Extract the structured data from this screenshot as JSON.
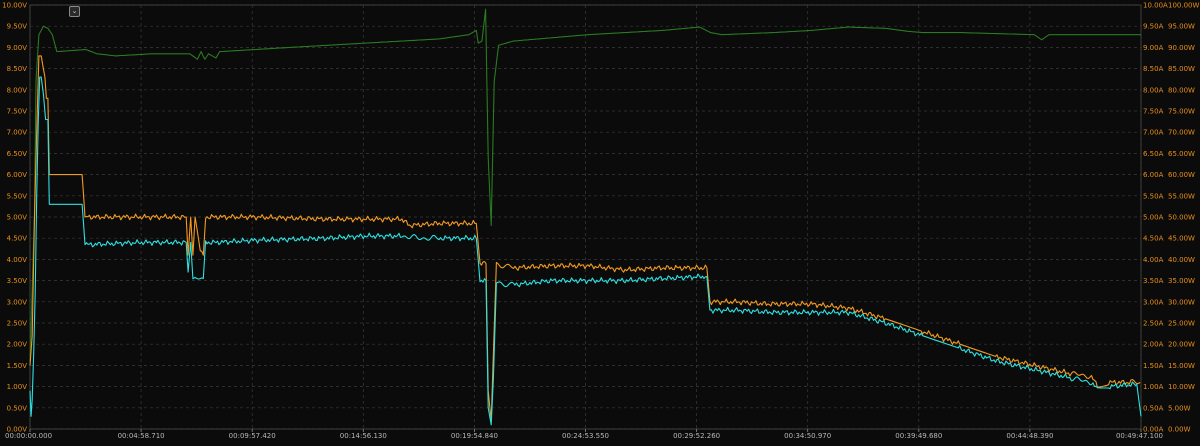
{
  "chart_data": {
    "type": "line",
    "title": "",
    "collapse_icon": "chevron-down-icon",
    "grid": true,
    "background": "#0b0b0b",
    "x_ticks": [
      "00:00:00.000",
      "00:04:58.710",
      "00:09:57.420",
      "00:14:56.130",
      "00:19:54.840",
      "00:24:53.550",
      "00:29:52.260",
      "00:34:50.970",
      "00:39:49.680",
      "00:44:48.390",
      "00:49:47.100"
    ],
    "x_range_seconds": [
      0,
      2987.1
    ],
    "axes": {
      "voltage": {
        "side": "left",
        "color": "#e8901c",
        "ylim": [
          0,
          10
        ],
        "ticks": [
          "0.00V",
          "0.50V",
          "1.00V",
          "1.50V",
          "2.00V",
          "2.50V",
          "3.00V",
          "3.50V",
          "4.00V",
          "4.50V",
          "5.00V",
          "5.50V",
          "6.00V",
          "6.50V",
          "7.00V",
          "7.50V",
          "8.00V",
          "8.50V",
          "9.00V",
          "9.50V",
          "10.00V"
        ]
      },
      "current": {
        "side": "right-inner",
        "color": "#e8901c",
        "ylim": [
          0,
          10
        ],
        "ticks": [
          "0.00A",
          "0.50A",
          "1.00A",
          "1.50A",
          "2.00A",
          "2.50A",
          "3.00A",
          "3.50A",
          "4.00A",
          "4.50A",
          "5.00A",
          "5.50A",
          "6.00A",
          "6.50A",
          "7.00A",
          "7.50A",
          "8.00A",
          "8.50A",
          "9.00A",
          "9.50A",
          "10.00A"
        ]
      },
      "power": {
        "side": "right-outer",
        "color": "#e8901c",
        "ylim": [
          0,
          100
        ],
        "ticks": [
          "0.00W",
          "5.00W",
          "10.00W",
          "15.00W",
          "20.00W",
          "25.00W",
          "30.00W",
          "35.00W",
          "40.00W",
          "45.00W",
          "50.00W",
          "55.00W",
          "60.00W",
          "65.00W",
          "70.00W",
          "75.00W",
          "80.00W",
          "85.00W",
          "90.00W",
          "95.00W",
          "100.00W"
        ]
      }
    },
    "series": [
      {
        "color": "#2a7a22",
        "axis": "voltage",
        "points": [
          [
            0,
            1.6
          ],
          [
            12,
            5.1
          ],
          [
            16,
            8.2
          ],
          [
            24,
            9.3
          ],
          [
            36,
            9.5
          ],
          [
            48,
            9.45
          ],
          [
            60,
            9.3
          ],
          [
            72,
            8.9
          ],
          [
            150,
            8.95
          ],
          [
            180,
            8.85
          ],
          [
            230,
            8.8
          ],
          [
            330,
            8.85
          ],
          [
            430,
            8.85
          ],
          [
            450,
            8.72
          ],
          [
            460,
            8.9
          ],
          [
            470,
            8.72
          ],
          [
            480,
            8.85
          ],
          [
            500,
            8.75
          ],
          [
            510,
            8.9
          ],
          [
            700,
            9.0
          ],
          [
            900,
            9.1
          ],
          [
            1100,
            9.2
          ],
          [
            1180,
            9.3
          ],
          [
            1200,
            9.4
          ],
          [
            1205,
            9.1
          ],
          [
            1215,
            9.15
          ],
          [
            1225,
            9.9
          ],
          [
            1232,
            6.4
          ],
          [
            1240,
            4.8
          ],
          [
            1248,
            8.2
          ],
          [
            1260,
            9.05
          ],
          [
            1300,
            9.15
          ],
          [
            1500,
            9.3
          ],
          [
            1700,
            9.4
          ],
          [
            1800,
            9.48
          ],
          [
            1830,
            9.35
          ],
          [
            1860,
            9.3
          ],
          [
            2000,
            9.35
          ],
          [
            2100,
            9.4
          ],
          [
            2200,
            9.48
          ],
          [
            2300,
            9.45
          ],
          [
            2360,
            9.38
          ],
          [
            2400,
            9.35
          ],
          [
            2500,
            9.35
          ],
          [
            2700,
            9.3
          ],
          [
            2720,
            9.18
          ],
          [
            2740,
            9.3
          ],
          [
            2987,
            9.3
          ]
        ]
      },
      {
        "color": "#f29a22",
        "axis": "voltage",
        "points": [
          [
            0,
            1.5
          ],
          [
            6,
            2.2
          ],
          [
            12,
            5.0
          ],
          [
            18,
            7.0
          ],
          [
            24,
            8.8
          ],
          [
            30,
            8.8
          ],
          [
            40,
            8.3
          ],
          [
            44,
            7.8
          ],
          [
            48,
            7.8
          ],
          [
            52,
            6.0
          ],
          [
            60,
            6.0
          ],
          [
            140,
            6.0
          ],
          [
            148,
            5.0
          ],
          [
            160,
            5.0
          ],
          [
            300,
            5.0
          ],
          [
            420,
            5.0
          ],
          [
            425,
            4.1
          ],
          [
            432,
            5.0
          ],
          [
            438,
            4.1
          ],
          [
            444,
            5.0
          ],
          [
            458,
            4.2
          ],
          [
            466,
            4.1
          ],
          [
            472,
            5.0
          ],
          [
            600,
            5.0
          ],
          [
            800,
            4.95
          ],
          [
            1000,
            4.95
          ],
          [
            1020,
            4.8
          ],
          [
            1100,
            4.85
          ],
          [
            1200,
            4.85
          ],
          [
            1210,
            3.9
          ],
          [
            1226,
            3.9
          ],
          [
            1232,
            0.9
          ],
          [
            1240,
            0.2
          ],
          [
            1246,
            1.8
          ],
          [
            1254,
            3.9
          ],
          [
            1300,
            3.8
          ],
          [
            1400,
            3.85
          ],
          [
            1500,
            3.85
          ],
          [
            1600,
            3.75
          ],
          [
            1700,
            3.8
          ],
          [
            1820,
            3.8
          ],
          [
            1828,
            3.0
          ],
          [
            1900,
            3.0
          ],
          [
            1980,
            2.95
          ],
          [
            2100,
            2.95
          ],
          [
            2200,
            2.85
          ],
          [
            2300,
            2.6
          ],
          [
            2400,
            2.3
          ],
          [
            2500,
            2.0
          ],
          [
            2600,
            1.7
          ],
          [
            2700,
            1.5
          ],
          [
            2800,
            1.3
          ],
          [
            2850,
            1.25
          ],
          [
            2870,
            1.05
          ],
          [
            2900,
            1.1
          ],
          [
            2960,
            1.1
          ],
          [
            2985,
            1.1
          ]
        ]
      },
      {
        "color": "#2ee0e0",
        "axis": "voltage",
        "points": [
          [
            0,
            0.9
          ],
          [
            3,
            0.3
          ],
          [
            6,
            0.7
          ],
          [
            10,
            1.8
          ],
          [
            14,
            3.2
          ],
          [
            18,
            5.5
          ],
          [
            22,
            7.2
          ],
          [
            26,
            8.3
          ],
          [
            30,
            8.3
          ],
          [
            36,
            7.9
          ],
          [
            42,
            7.3
          ],
          [
            48,
            7.3
          ],
          [
            52,
            5.3
          ],
          [
            60,
            5.3
          ],
          [
            140,
            5.3
          ],
          [
            148,
            4.35
          ],
          [
            160,
            4.35
          ],
          [
            300,
            4.4
          ],
          [
            420,
            4.4
          ],
          [
            425,
            3.7
          ],
          [
            432,
            4.4
          ],
          [
            438,
            3.55
          ],
          [
            444,
            3.55
          ],
          [
            466,
            3.55
          ],
          [
            472,
            4.4
          ],
          [
            500,
            4.4
          ],
          [
            600,
            4.45
          ],
          [
            800,
            4.5
          ],
          [
            900,
            4.55
          ],
          [
            1000,
            4.55
          ],
          [
            1050,
            4.5
          ],
          [
            1100,
            4.5
          ],
          [
            1200,
            4.5
          ],
          [
            1210,
            3.5
          ],
          [
            1226,
            3.5
          ],
          [
            1232,
            0.5
          ],
          [
            1240,
            0.1
          ],
          [
            1246,
            1.2
          ],
          [
            1254,
            3.45
          ],
          [
            1300,
            3.4
          ],
          [
            1400,
            3.5
          ],
          [
            1500,
            3.5
          ],
          [
            1600,
            3.5
          ],
          [
            1700,
            3.55
          ],
          [
            1820,
            3.6
          ],
          [
            1828,
            2.8
          ],
          [
            1900,
            2.8
          ],
          [
            2000,
            2.75
          ],
          [
            2100,
            2.75
          ],
          [
            2200,
            2.75
          ],
          [
            2300,
            2.5
          ],
          [
            2400,
            2.2
          ],
          [
            2500,
            1.9
          ],
          [
            2600,
            1.6
          ],
          [
            2700,
            1.4
          ],
          [
            2800,
            1.2
          ],
          [
            2850,
            1.1
          ],
          [
            2870,
            0.95
          ],
          [
            2900,
            1.0
          ],
          [
            2960,
            1.05
          ],
          [
            2976,
            1.05
          ],
          [
            2987,
            0.3
          ]
        ]
      }
    ]
  }
}
